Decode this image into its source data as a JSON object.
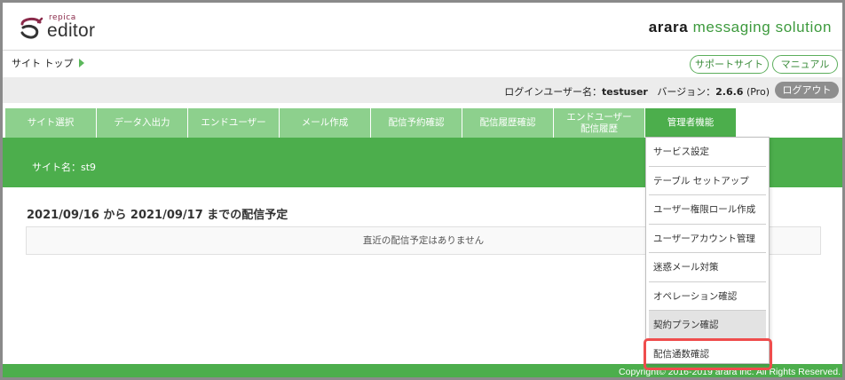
{
  "logo": {
    "small": "repica",
    "main": "editor"
  },
  "brand": {
    "part1": "arara",
    "part2": " messaging solution"
  },
  "breadcrumb": {
    "label": "サイト トップ"
  },
  "links": {
    "support": "サポートサイト",
    "manual": "マニュアル"
  },
  "userbar": {
    "login_label": "ログインユーザー名：",
    "username": "testuser",
    "version_label": "バージョン：",
    "version": "2.6.6",
    "edition": "(Pro)",
    "logout": "ログアウト"
  },
  "nav": {
    "tabs": [
      {
        "label": "サイト選択"
      },
      {
        "label": "データ入出力"
      },
      {
        "label": "エンドユーザー"
      },
      {
        "label": "メール作成"
      },
      {
        "label": "配信予約確認"
      },
      {
        "label": "配信履歴確認"
      },
      {
        "label_line1": "エンドユーザー",
        "label_line2": "配信履歴"
      },
      {
        "label": "管理者機能"
      }
    ]
  },
  "site": {
    "name_label": "サイト名：",
    "name": "st9"
  },
  "schedule": {
    "title": "2021/09/16 から 2021/09/17 までの配信予定",
    "empty_message": "直近の配信予定はありません"
  },
  "admin_menu": {
    "items": [
      {
        "label": "サービス設定"
      },
      {
        "label": "テーブル セットアップ"
      },
      {
        "label": "ユーザー権限ロール作成"
      },
      {
        "label": "ユーザーアカウント管理"
      },
      {
        "label": "迷惑メール対策"
      },
      {
        "label": "オペレーション確認"
      },
      {
        "label": "契約プラン確認"
      },
      {
        "label": "配信通数確認"
      }
    ]
  },
  "footer": {
    "copyright": "Copyright© 2016-2019 arara inc. All Rights Reserved."
  },
  "colors": {
    "green": "#4cae4c",
    "green_light": "#8dd08d",
    "highlight": "#ef4d4d"
  }
}
